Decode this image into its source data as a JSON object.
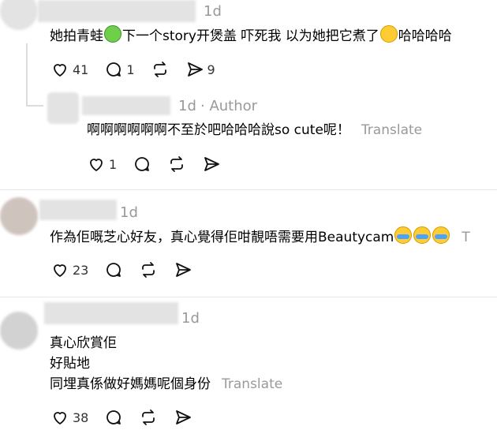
{
  "comments": [
    {
      "time": "1d",
      "text_parts": [
        "她拍青蛙",
        "下一个story开煲盖 吓死我 以为她把它煮了",
        "哈哈哈哈"
      ],
      "emoji_frog": "frog-emoji",
      "emoji_laugh": "face-with-tears-of-joy-emoji",
      "likes": "41",
      "replies": "1",
      "reposts": "",
      "shares": "9"
    },
    {
      "time": "1d",
      "author_tag": "· Author",
      "text": "啊啊啊啊啊啊不至於吧哈哈哈說so cute呢！",
      "translate": "Translate",
      "likes": "1",
      "replies": "",
      "reposts": "",
      "shares": ""
    },
    {
      "time": "1d",
      "text": "作為佢嘅芝心好友，真心覺得佢咁靚唔需要用Beautycam",
      "trailing": "T",
      "emoji_cry": "loudly-crying-face-emoji",
      "likes": "23"
    },
    {
      "time": "1d",
      "lines": [
        "真心欣賞佢",
        "好貼地",
        "同埋真係做好媽媽呢個身份"
      ],
      "translate": "Translate",
      "likes": "38"
    }
  ],
  "icons": {
    "like": "heart-icon",
    "reply": "comment-icon",
    "repost": "repost-icon",
    "share": "share-icon"
  },
  "colors": {
    "muted": "#999999",
    "divider": "#e6e6e6"
  }
}
